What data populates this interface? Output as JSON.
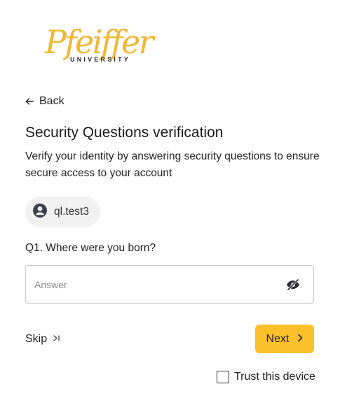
{
  "logo": {
    "word": "Pfeiffer",
    "subtitle": "UNIVERSITY"
  },
  "nav": {
    "back_label": "Back",
    "back_icon": "arrow-left-icon"
  },
  "page": {
    "title": "Security Questions verification",
    "description": "Verify your identity by answering security questions to ensure secure access to your account"
  },
  "user": {
    "username": "ql.test3",
    "icon": "user-circle-icon"
  },
  "question": {
    "label": "Q1. Where were you born?",
    "answer_value": "",
    "answer_placeholder": "Answer",
    "visibility_icon": "eye-slash-icon"
  },
  "actions": {
    "skip_label": "Skip",
    "next_label": "Next",
    "trust_label": "Trust this device",
    "trust_checked": false
  },
  "colors": {
    "brand_gold": "#f2b632",
    "button_yellow": "#fcc12a",
    "chip_bg": "#f1f1f1"
  }
}
